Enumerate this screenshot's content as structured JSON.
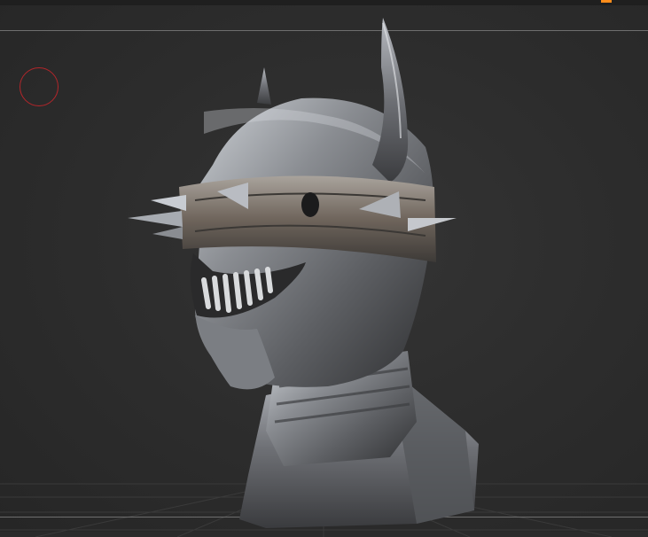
{
  "app": {
    "name": ""
  },
  "colors": {
    "background": "#2b2b2b",
    "accent": "#ff8c1a",
    "brush_cursor": "#b3262a",
    "guide_line": "#6e6e6e"
  },
  "viewport": {
    "model": "sculpted-bust-helmeted-head",
    "material": "metallic-silver"
  },
  "icons": {
    "brush_cursor": "circle-brush-icon",
    "accent_marker": "orange-tab-indicator"
  }
}
